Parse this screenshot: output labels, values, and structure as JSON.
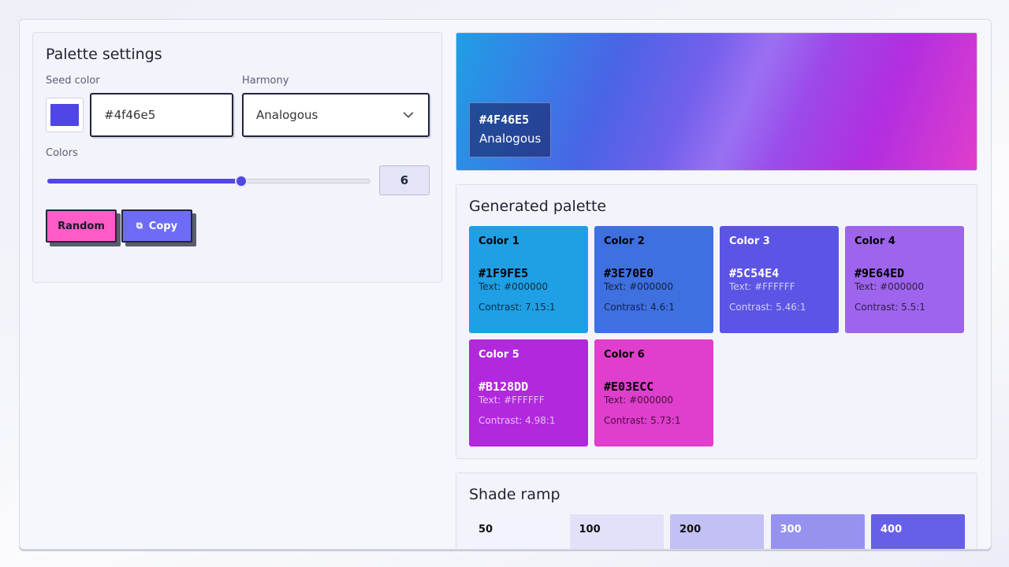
{
  "settings": {
    "title": "Palette settings",
    "seed_label": "Seed color",
    "seed_value": "#4f46e5",
    "seed_color": "#4f46e5",
    "harmony_label": "Harmony",
    "harmony_value": "Analogous",
    "colors_label": "Colors",
    "colors_count": "6",
    "colors_slider_fraction": 0.6,
    "random_label": "Random",
    "copy_label": "Copy"
  },
  "hero": {
    "hex": "#4F46E5",
    "harmony": "Analogous"
  },
  "palette": {
    "title": "Generated palette",
    "swatches": [
      {
        "name": "Color 1",
        "hex": "#1F9FE5",
        "text": "Text: #000000",
        "contrast": "Contrast: 7.15:1",
        "bg": "#1f9fe5",
        "fg": "#000000"
      },
      {
        "name": "Color 2",
        "hex": "#3E70E0",
        "text": "Text: #000000",
        "contrast": "Contrast: 4.6:1",
        "bg": "#3e70e0",
        "fg": "#000000"
      },
      {
        "name": "Color 3",
        "hex": "#5C54E4",
        "text": "Text: #FFFFFF",
        "contrast": "Contrast: 5.46:1",
        "bg": "#5c54e4",
        "fg": "#ffffff"
      },
      {
        "name": "Color 4",
        "hex": "#9E64ED",
        "text": "Text: #000000",
        "contrast": "Contrast: 5.5:1",
        "bg": "#9e64ed",
        "fg": "#000000"
      },
      {
        "name": "Color 5",
        "hex": "#B128DD",
        "text": "Text: #FFFFFF",
        "contrast": "Contrast: 4.98:1",
        "bg": "#b128dd",
        "fg": "#ffffff"
      },
      {
        "name": "Color 6",
        "hex": "#E03ECC",
        "text": "Text: #000000",
        "contrast": "Contrast: 5.73:1",
        "bg": "#e03ecc",
        "fg": "#000000"
      }
    ]
  },
  "ramp": {
    "title": "Shade ramp",
    "shades": [
      {
        "label": "50",
        "bg": "#f3f3fd",
        "fg": "#111111"
      },
      {
        "label": "100",
        "bg": "#e2e1fa",
        "fg": "#111111"
      },
      {
        "label": "200",
        "bg": "#c3c0f5",
        "fg": "#111111"
      },
      {
        "label": "300",
        "bg": "#9792ef",
        "fg": "#ffffff"
      },
      {
        "label": "400",
        "bg": "#6660e8",
        "fg": "#ffffff"
      }
    ]
  }
}
